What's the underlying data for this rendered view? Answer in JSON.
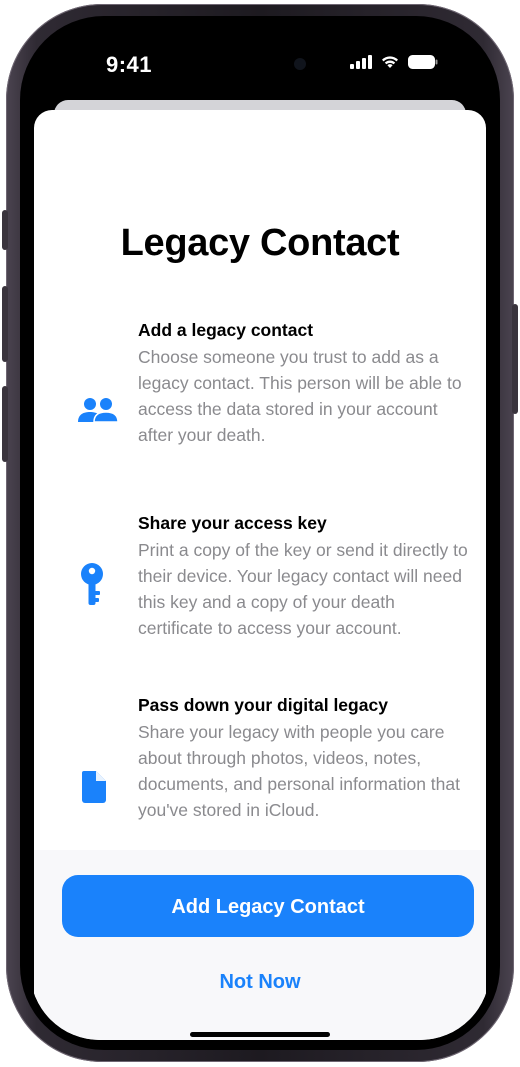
{
  "status_bar": {
    "time": "9:41",
    "icons": [
      "cellular-signal-icon",
      "wifi-icon",
      "battery-icon"
    ]
  },
  "sheet": {
    "title": "Legacy Contact",
    "features": [
      {
        "icon": "people-icon",
        "title": "Add a legacy contact",
        "body": "Choose someone you trust to add as a legacy contact. This person will be able to access the data stored in your account after your death."
      },
      {
        "icon": "key-icon",
        "title": "Share your access key",
        "body": "Print a copy of the key or send it directly to their device. Your legacy contact will need this key and a copy of your death certificate to access your account."
      },
      {
        "icon": "document-icon",
        "title": "Pass down your digital legacy",
        "body": "Share your legacy with people you care about through photos, videos, notes, documents, and personal information that you've stored in iCloud."
      }
    ],
    "primary_button": "Add Legacy Contact",
    "secondary_button": "Not Now"
  },
  "colors": {
    "accent": "#1a82fb",
    "title_text": "#000000",
    "body_text": "#8a8a8e",
    "sheet_background": "#ffffff",
    "bottom_background": "#f8f8fa"
  }
}
